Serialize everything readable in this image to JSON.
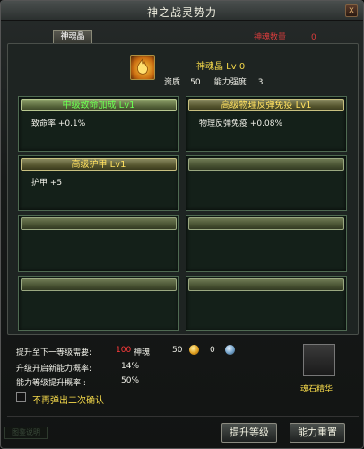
{
  "window": {
    "title": "神之战灵势力",
    "close_label": "x"
  },
  "tab": {
    "label": "神魂晶"
  },
  "count": {
    "label": "神魂数量",
    "value": "0"
  },
  "item": {
    "name": "神魂晶 Lv 0",
    "quality_label": "资质",
    "quality_value": "50",
    "strength_label": "能力强度",
    "strength_value": "3",
    "icon": "flame-crystal-icon"
  },
  "boxes": [
    {
      "title": "中级致命加成 Lv1",
      "text": "致命率 +0.1%"
    },
    {
      "title": "高级物理反弹免疫 Lv1",
      "text": "物理反弹免疫 +0.08%"
    },
    {
      "title": "高级护甲 Lv1",
      "text": "护甲 +5"
    },
    {
      "title": "",
      "text": ""
    },
    {
      "title": "",
      "text": ""
    },
    {
      "title": "",
      "text": ""
    },
    {
      "title": "",
      "text": ""
    },
    {
      "title": "",
      "text": ""
    }
  ],
  "upgrade": {
    "need_label": "提升至下一等级需要:",
    "need_value": "100",
    "need_unit": "神魂",
    "gold": "50",
    "silver": "0",
    "new_ability_label": "升级开启新能力概率:",
    "new_ability_value": "14%",
    "level_up_label": "能力等级提升概率 :",
    "level_up_value": "50%"
  },
  "essence": {
    "label": "魂石精华"
  },
  "confirm": {
    "label": "不再弹出二次确认"
  },
  "buttons": {
    "ghost": "图鉴说明",
    "upgrade": "提升等级",
    "reset": "能力重置"
  },
  "colors": {
    "green_title": "#6cff52",
    "gold_title": "#ffe060",
    "red": "#ff3b3b"
  }
}
